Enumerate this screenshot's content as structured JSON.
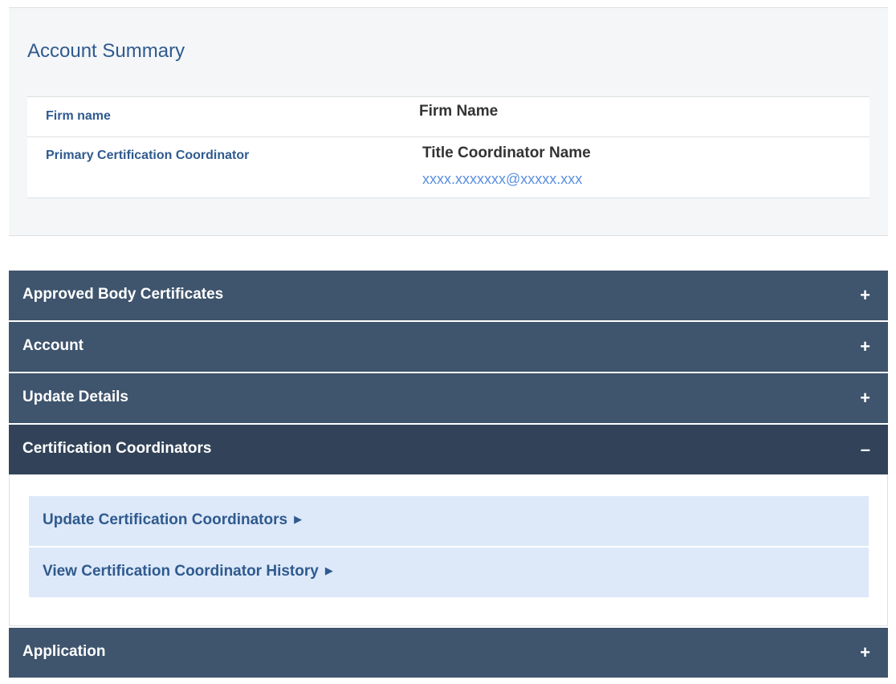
{
  "summary": {
    "title": "Account Summary",
    "rows": [
      {
        "label": "Firm name",
        "value": "Firm Name"
      },
      {
        "label": "Primary Certification Coordinator",
        "value": "Title Coordinator Name",
        "email": "xxxx.xxxxxxx@xxxxx.xxx"
      }
    ]
  },
  "accordion": {
    "sections": [
      {
        "title": "Approved Body Certificates",
        "toggle": "+",
        "expanded": false
      },
      {
        "title": "Account",
        "toggle": "+",
        "expanded": false
      },
      {
        "title": "Update Details",
        "toggle": "+",
        "expanded": false
      },
      {
        "title": "Certification Coordinators",
        "toggle": "–",
        "expanded": true,
        "links": [
          {
            "label": "Update Certification Coordinators",
            "arrow": "▶"
          },
          {
            "label": "View Certification Coordinator History",
            "arrow": "▶"
          }
        ]
      },
      {
        "title": "Application",
        "toggle": "+",
        "expanded": false
      }
    ]
  },
  "colors": {
    "header_bg": "#3f546d",
    "header_open_bg": "#324359",
    "link_bg": "#dde9f9",
    "link_text": "#2f5a8e",
    "email": "#5a8fe0"
  }
}
